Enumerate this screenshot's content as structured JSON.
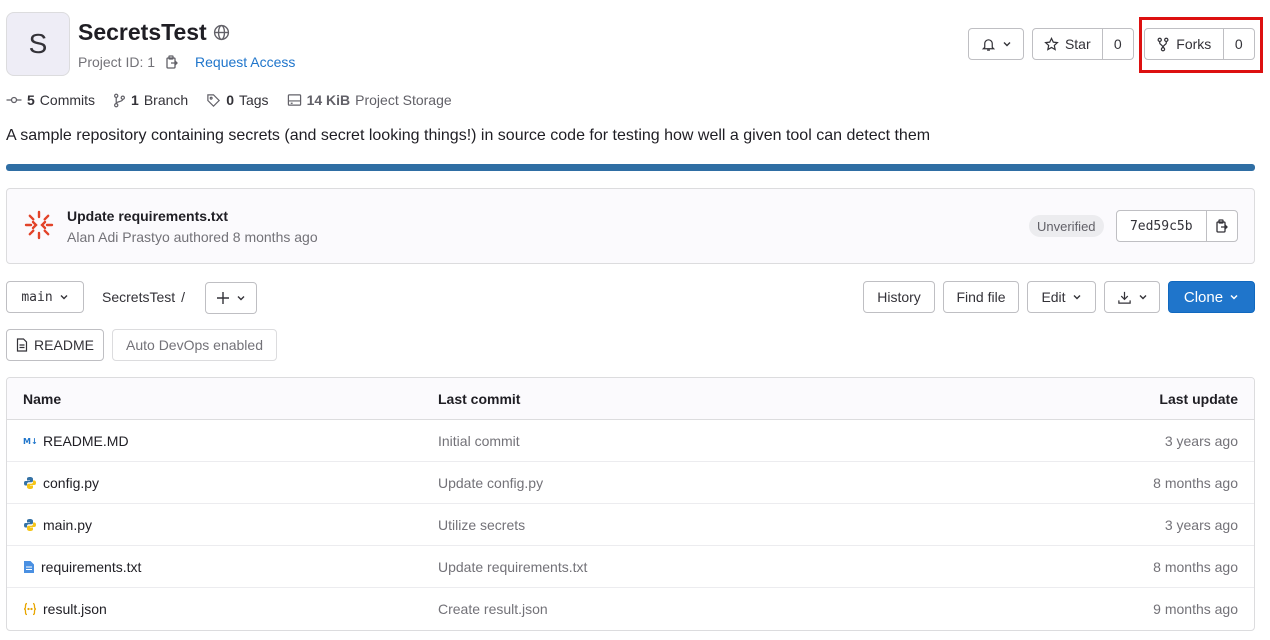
{
  "project": {
    "avatar_letter": "S",
    "name": "SecretsTest",
    "project_id": "Project ID: 1",
    "request_access": "Request Access"
  },
  "actions": {
    "star_label": "Star",
    "star_count": "0",
    "forks_label": "Forks",
    "forks_count": "0"
  },
  "stats": {
    "commits_count": "5",
    "commits_label": "Commits",
    "branch_count": "1",
    "branch_label": "Branch",
    "tags_count": "0",
    "tags_label": "Tags",
    "storage_size": "14 KiB",
    "storage_label": "Project Storage"
  },
  "description": "A sample repository containing secrets (and secret looking things!) in source code for testing how well a given tool can detect them",
  "commit": {
    "title": "Update requirements.txt",
    "author_line": "Alan Adi Prastyo authored 8 months ago",
    "badge": "Unverified",
    "sha": "7ed59c5b"
  },
  "toolbar": {
    "branch": "main",
    "path": "SecretsTest",
    "separator": "/",
    "history": "History",
    "find_file": "Find file",
    "edit": "Edit",
    "clone": "Clone"
  },
  "chips": {
    "readme": "README",
    "autodevops": "Auto DevOps enabled"
  },
  "table": {
    "headers": {
      "name": "Name",
      "last_commit": "Last commit",
      "last_update": "Last update"
    },
    "rows": [
      {
        "name": "README.MD",
        "commit": "Initial commit",
        "updated": "3 years ago",
        "icon": "markdown-icon"
      },
      {
        "name": "config.py",
        "commit": "Update config.py",
        "updated": "8 months ago",
        "icon": "python-icon"
      },
      {
        "name": "main.py",
        "commit": "Utilize secrets",
        "updated": "3 years ago",
        "icon": "python-icon"
      },
      {
        "name": "requirements.txt",
        "commit": "Update requirements.txt",
        "updated": "8 months ago",
        "icon": "text-file-icon"
      },
      {
        "name": "result.json",
        "commit": "Create result.json",
        "updated": "9 months ago",
        "icon": "json-icon"
      }
    ]
  },
  "colors": {
    "accent": "#1f75cb",
    "progress_bar": "#2f6ea4",
    "highlight_border": "#dd1010"
  }
}
